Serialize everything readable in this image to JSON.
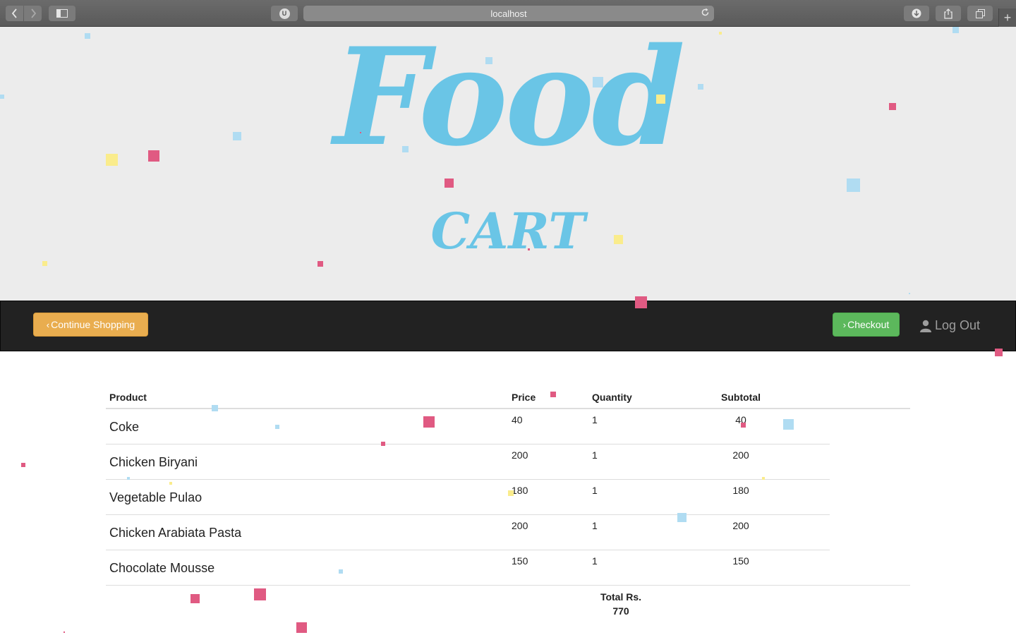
{
  "browser": {
    "url": "localhost",
    "extension_letter": "U",
    "new_tab": "+"
  },
  "hero": {
    "title": "Food",
    "subtitle": "CART"
  },
  "nav": {
    "continue_label": "Continue Shopping",
    "checkout_label": "Checkout",
    "logout_label": "Log Out"
  },
  "table": {
    "headers": {
      "product": "Product",
      "price": "Price",
      "quantity": "Quantity",
      "subtotal": "Subtotal"
    },
    "rows": [
      {
        "product": "Coke",
        "price": "40",
        "quantity": "1",
        "subtotal": "40"
      },
      {
        "product": "Chicken Biryani",
        "price": "200",
        "quantity": "1",
        "subtotal": "200"
      },
      {
        "product": "Vegetable Pulao",
        "price": "180",
        "quantity": "1",
        "subtotal": "180"
      },
      {
        "product": "Chicken Arabiata Pasta",
        "price": "200",
        "quantity": "1",
        "subtotal": "200"
      },
      {
        "product": "Chocolate Mousse",
        "price": "150",
        "quantity": "1",
        "subtotal": "150"
      }
    ],
    "total_label": "Total Rs.",
    "total_value": "770"
  },
  "colors": {
    "confetti_blue": "#b0dcf2",
    "confetti_pink": "#e05a82",
    "confetti_yellow": "#faec8c",
    "title_blue": "#6ac5e6",
    "continue_orange": "#e9ad4f",
    "checkout_green": "#5cb85c"
  }
}
